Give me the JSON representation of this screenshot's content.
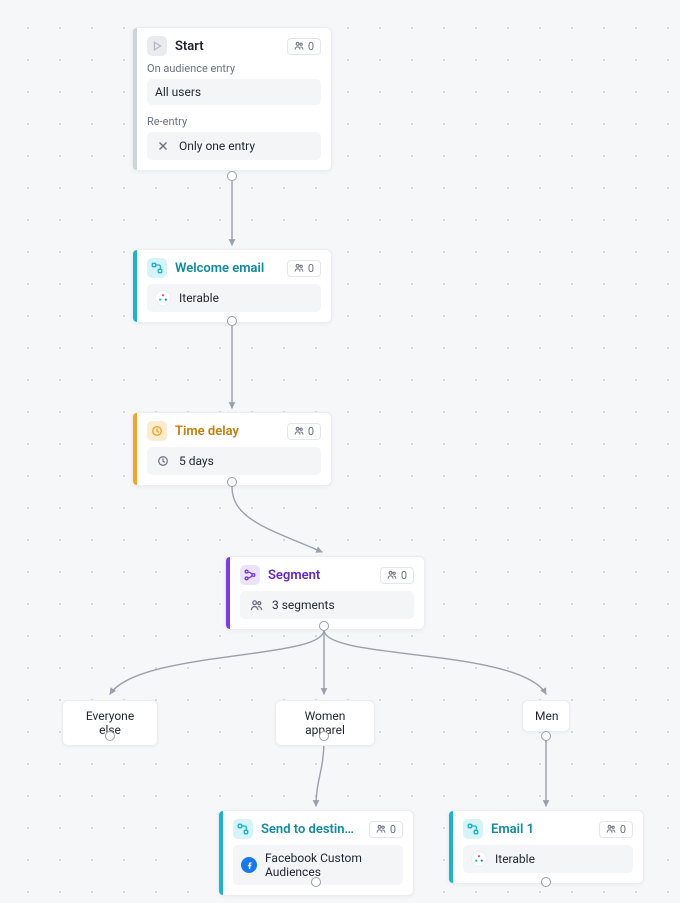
{
  "start": {
    "title": "Start",
    "count": "0",
    "audience_label": "On audience entry",
    "audience_value": "All users",
    "reentry_label": "Re-entry",
    "reentry_value": "Only one entry"
  },
  "welcome": {
    "title": "Welcome email",
    "count": "0",
    "provider": "Iterable"
  },
  "delay": {
    "title": "Time delay",
    "count": "0",
    "value": "5 days"
  },
  "segment": {
    "title": "Segment",
    "count": "0",
    "summary": "3 segments"
  },
  "branches": {
    "else": "Everyone else",
    "women": "Women apparel",
    "men": "Men"
  },
  "send": {
    "title": "Send to destination",
    "count": "0",
    "dest": "Facebook Custom Audiences"
  },
  "email1": {
    "title": "Email 1",
    "count": "0",
    "provider": "Iterable"
  }
}
